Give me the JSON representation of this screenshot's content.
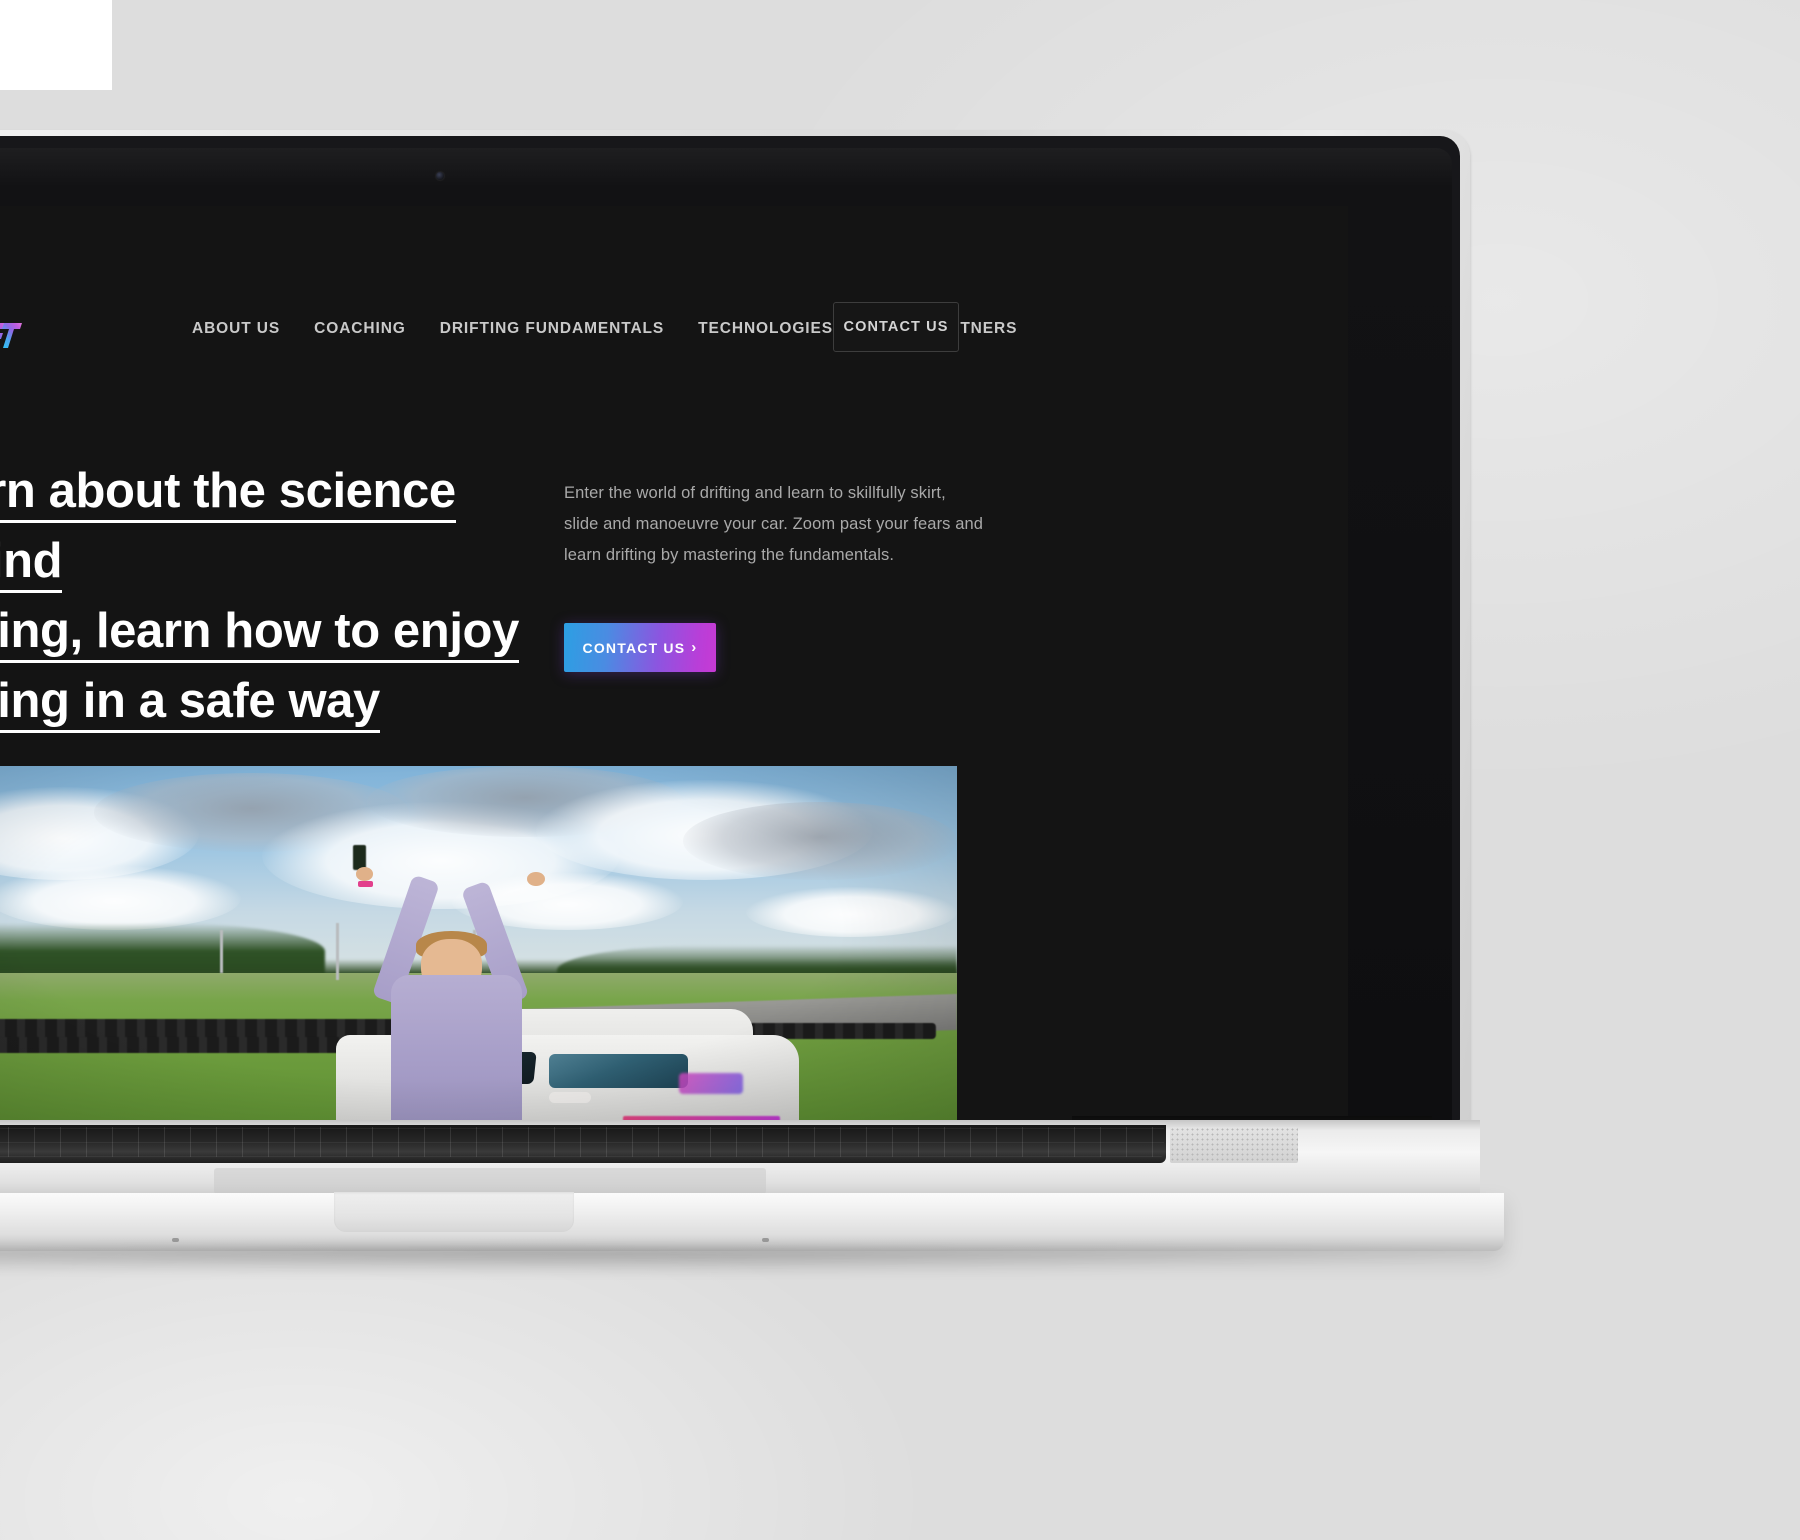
{
  "background": {
    "page_bg_color": "#dddddd",
    "white_block_color": "#ffffff"
  },
  "device": {
    "type": "laptop-mockup",
    "body_color": "#e9e9e9",
    "bezel_color": "#121214",
    "webcam": "webcam-dot"
  },
  "site": {
    "background_color": "#141414",
    "logo": {
      "text": "PM-DRIFT",
      "style": "graffiti-wordmark",
      "gradient_from": "#3bb6f0",
      "gradient_to": "#d04fe0"
    },
    "nav": {
      "items": [
        {
          "label": "ABOUT US"
        },
        {
          "label": "COACHING"
        },
        {
          "label": "DRIFTING FUNDAMENTALS"
        },
        {
          "label": "TECHNOLOGIES"
        },
        {
          "label": "MEDIA PARTNERS"
        }
      ],
      "contact_button": {
        "label": "CONTACT US",
        "border_color": "#3d3d3d"
      }
    },
    "hero": {
      "headline_lines": [
        "Learn about the science behind",
        "drifting, learn how to enjoy",
        "drifting in a safe way"
      ],
      "body": "Enter the world of drifting and learn to skillfully skirt, slide and manoeuvre your car. Zoom past your fears and learn drifting by mastering the fundamentals.",
      "cta": {
        "label": "CONTACT US",
        "chevron": "›",
        "gradient_from": "#2c9fe3",
        "gradient_to": "#c73ad4"
      }
    },
    "video": {
      "alt": "Young man in lavender hoodie celebrating with arms raised beside a white drift car on a racetrack under a cloudy sky",
      "play_label": "play-video"
    }
  }
}
